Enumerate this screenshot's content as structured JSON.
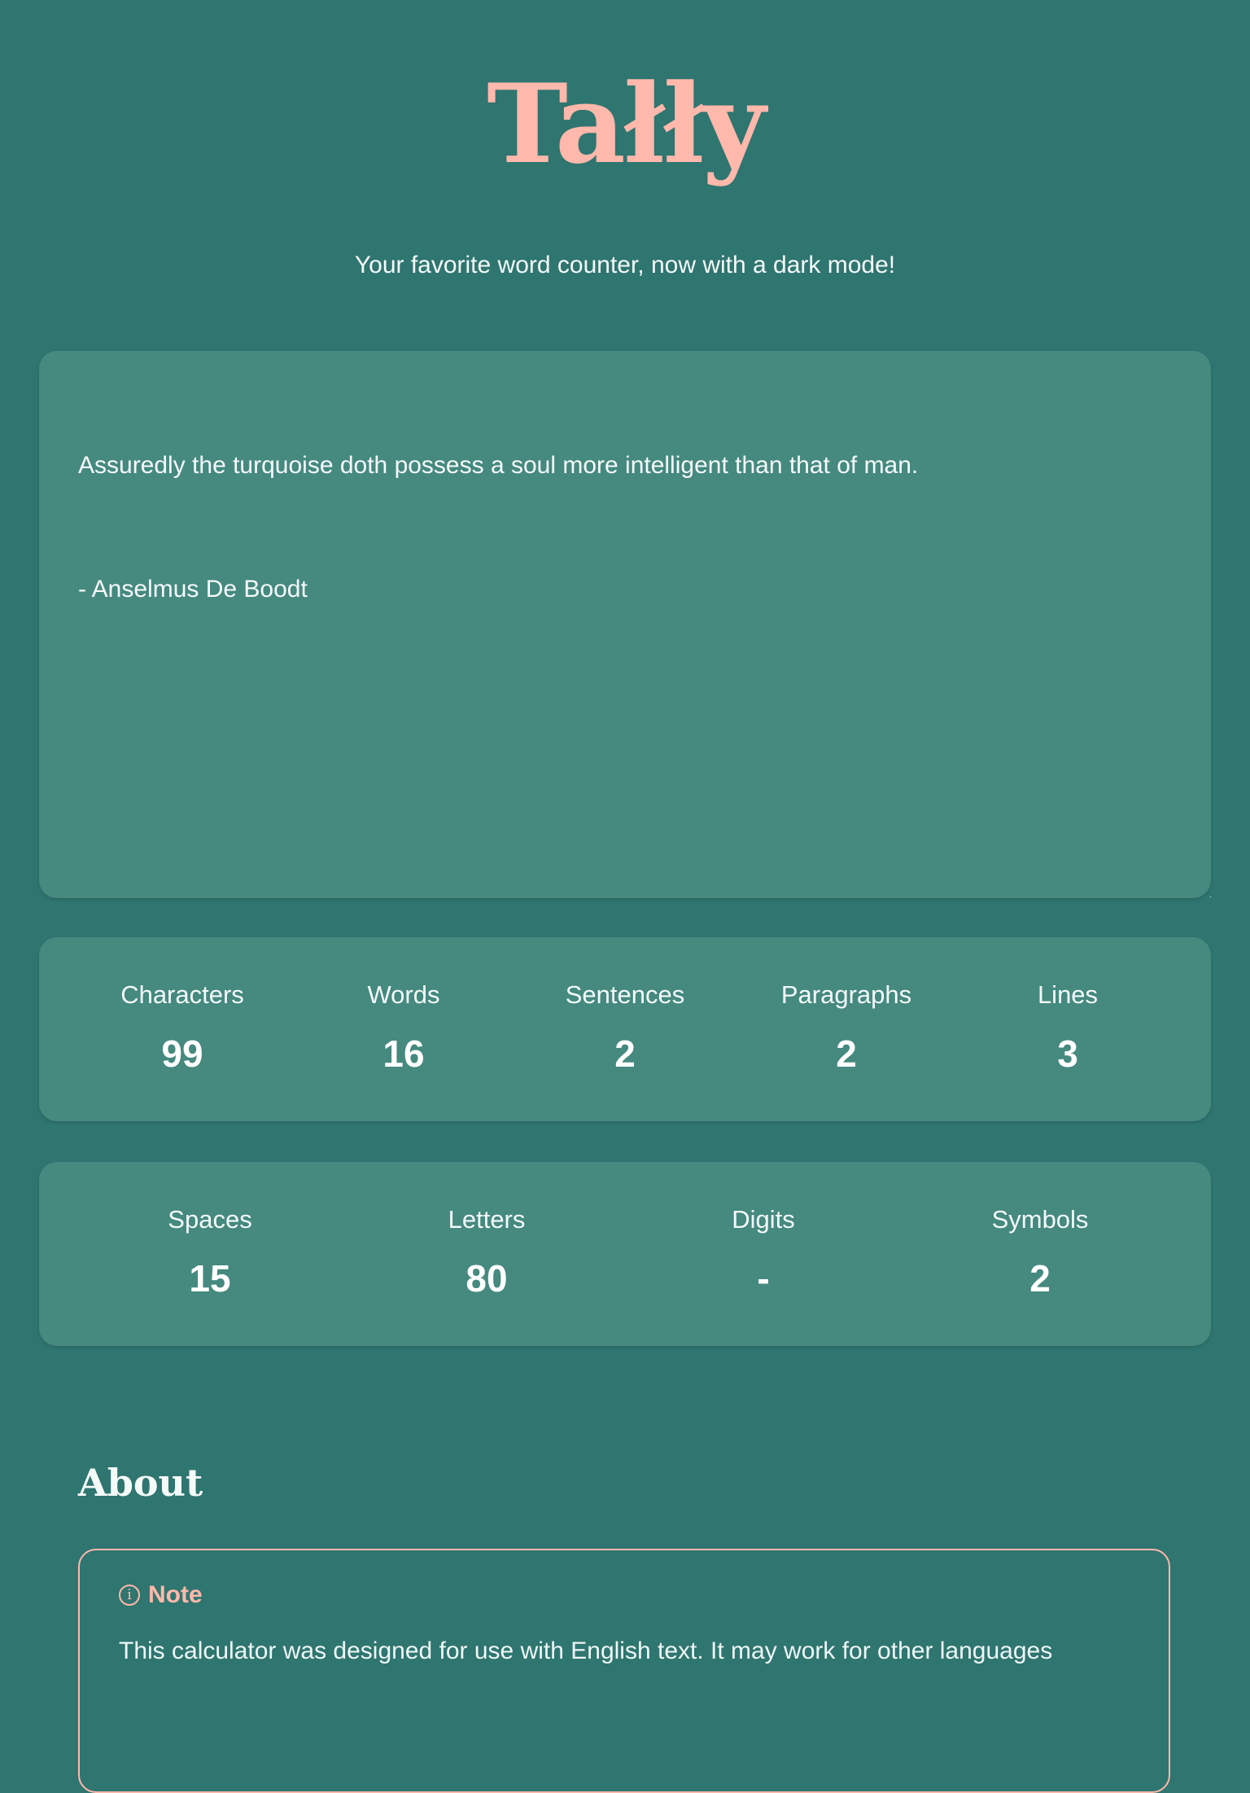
{
  "header": {
    "logo": "Tałły",
    "subtitle": "Your favorite word counter, now with a dark mode!"
  },
  "editor": {
    "text_line1": "Assuredly the turquoise doth possess a soul more intelligent than that of man.",
    "text_line2": "- Anselmus De Boodt"
  },
  "stats_primary": [
    {
      "label": "Characters",
      "value": "99"
    },
    {
      "label": "Words",
      "value": "16"
    },
    {
      "label": "Sentences",
      "value": "2"
    },
    {
      "label": "Paragraphs",
      "value": "2"
    },
    {
      "label": "Lines",
      "value": "3"
    }
  ],
  "stats_secondary": [
    {
      "label": "Spaces",
      "value": "15"
    },
    {
      "label": "Letters",
      "value": "80"
    },
    {
      "label": "Digits",
      "value": "-"
    },
    {
      "label": "Symbols",
      "value": "2"
    }
  ],
  "about": {
    "heading": "About",
    "note_title": "Note",
    "note_icon": "info-icon",
    "note_text": "This calculator was designed for use with English text. It may work for other languages"
  },
  "colors": {
    "background": "#2f7570",
    "card": "#45897f",
    "accent": "#ffb8ab"
  }
}
